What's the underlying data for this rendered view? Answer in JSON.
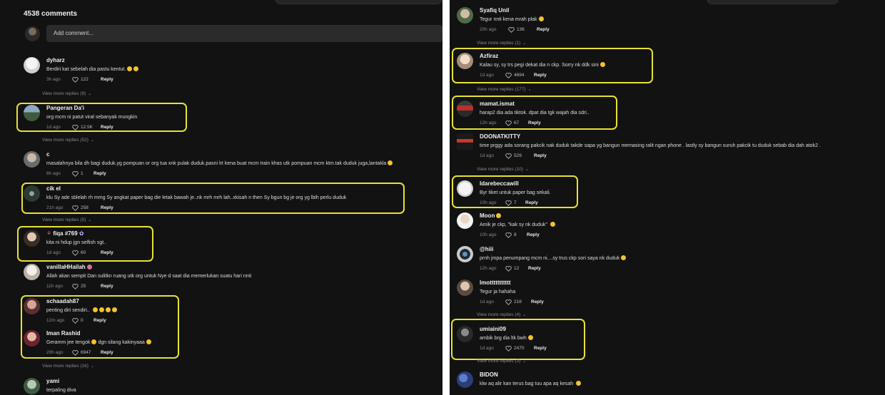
{
  "left": {
    "header": {
      "comments_count": "4538 comments"
    },
    "add_comment": {
      "placeholder": "Add comment..."
    },
    "comments": [
      {
        "name": "dyharz",
        "text": "Berdiri kat sebelah dia pastu kentut.",
        "time": "3h ago",
        "likes": "122",
        "reply": "Reply",
        "emojis": 2
      },
      {
        "name": "Pangeran Da'i",
        "text": "org mcm ni patut viral sebanyak mungkin",
        "time": "1d ago",
        "likes": "12.5K",
        "reply": "Reply"
      },
      {
        "name": "c",
        "text": "masalahnya bila dh bagi duduk.yg pompuan or org tua xnk pulak duduk.pasni lrt kena buat mcm train khas utk pompuan mcm ktm.tak duduk juga,lantakla",
        "time": "8h ago",
        "likes": "1",
        "reply": "Reply",
        "emojis": 1
      },
      {
        "name": "cik el",
        "text": "klu Sy ade sblelah rh mmg Sy angkat paper bag die letak bawah je..nk mrh mrh lah..xkisah n then Sy bgun bg je org yg lbih perlu duduk",
        "time": "21h ago",
        "likes": "258",
        "reply": "Reply"
      },
      {
        "name": "fiqa #769",
        "text": "kita ni hdup jgn selfish sgt..",
        "time": "1d ago",
        "likes": "60",
        "reply": "Reply"
      },
      {
        "name": "vanillaHHailah",
        "text": "Allah akan sempit Dan sulitkn ruang utk org untuk Nye d saat dia memerlukan suatu hari nnti",
        "time": "11h ago",
        "likes": "25",
        "reply": "Reply"
      },
      {
        "name": "schaadah87",
        "text": "penting diri sendiri..",
        "time": "12m ago",
        "likes": "0",
        "reply": "Reply",
        "emojis": 4
      },
      {
        "name": "Iman Rashid",
        "text": "Geramm jee tengok",
        "text2": "dgn silang kakinyaaa",
        "time": "20h ago",
        "likes": "6947",
        "reply": "Reply"
      },
      {
        "name": "yami",
        "text": "terpaling diva",
        "time": "",
        "likes": "",
        "reply": ""
      }
    ],
    "view_more": [
      "View more replies (9)",
      "View more replies (52)",
      "View more replies (5)",
      "View more replies (16)"
    ]
  },
  "right": {
    "comments": [
      {
        "name": "Syafiq Unil",
        "text": "Tegur nnti kena mrah plak",
        "time": "20h ago",
        "likes": "136",
        "reply": "Reply",
        "emojis": 1
      },
      {
        "name": "Azfiraz",
        "text": "Kalau sy, sy trs pegi dekat dia n ckp. Sorry nk ddk sini",
        "time": "1d ago",
        "likes": "4694",
        "reply": "Reply",
        "emojis": 1
      },
      {
        "name": "mamat.ismat",
        "text": "harap2 dia ada tiktok. dpat dia tgk wajah dia sdri..",
        "time": "12h ago",
        "likes": "67",
        "reply": "Reply"
      },
      {
        "name": "DOONATKITTY",
        "text": "time prggy ada sorang pakcik nak duduk takde sapa yg bangun memasing ralit ngan phone . lastly sy bangun suruh pakcik tu duduk sebab dia dah atok2 .",
        "time": "1d ago",
        "likes": "529",
        "reply": "Reply"
      },
      {
        "name": "Idarebeccawill",
        "text": "Byr tiket untuk paper bag sekali.",
        "time": "10h ago",
        "likes": "7",
        "reply": "Reply"
      },
      {
        "name": "Moon",
        "text": "Amik je ckp, \"kak sy nk duduk\"",
        "time": "10h ago",
        "likes": "8",
        "reply": "Reply",
        "emojis": 1
      },
      {
        "name": "@hiii",
        "text": "prnh jmpa penumpang mcm ni....sy trus ckp sori saya nk duduk",
        "time": "12h ago",
        "likes": "12",
        "reply": "Reply",
        "emojis": 1
      },
      {
        "name": "lmottttttttttt",
        "text": "Tegur ja hahaha",
        "time": "1d ago",
        "likes": "218",
        "reply": "Reply"
      },
      {
        "name": "umiaini09",
        "text": "ambik brg dia ltk bwh",
        "time": "1d ago",
        "likes": "2470",
        "reply": "Reply",
        "emojis": 1
      },
      {
        "name": "BIDON",
        "text": "klw aq alir kan terus bag tuu apa aq kesah",
        "time": "",
        "likes": "",
        "reply": "",
        "emojis": 1
      }
    ],
    "view_more": [
      "View more replies (1)",
      "View more replies (177)",
      "View more replies (10)",
      "View more replies (4)",
      "View more replies (3)"
    ]
  },
  "colors": {
    "background": "#121212",
    "highlight": "#e6e233",
    "text": "#e9e9e9",
    "muted": "#8a8a8a"
  },
  "icons": [
    "heart-icon",
    "chevron-down-icon",
    "avatar"
  ]
}
